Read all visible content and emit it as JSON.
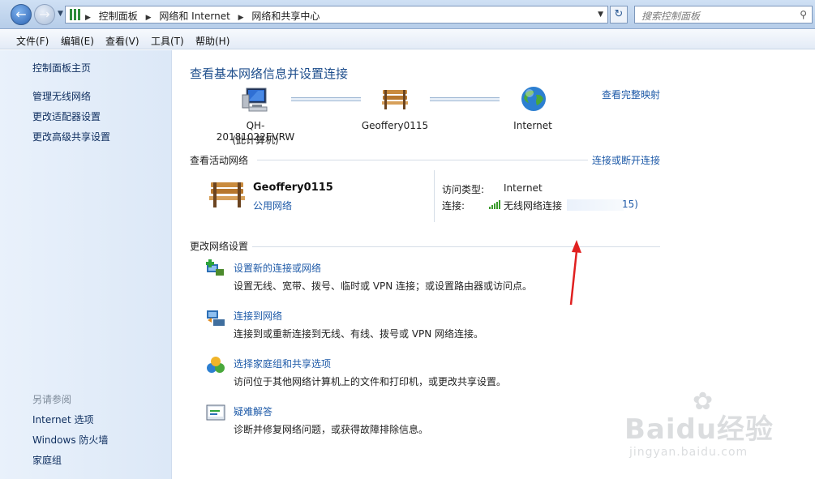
{
  "addressbar": {
    "crumbs": [
      "控制面板",
      "网络和 Internet",
      "网络和共享中心"
    ],
    "search_placeholder": "搜索控制面板"
  },
  "menubar": [
    "文件(F)",
    "编辑(E)",
    "查看(V)",
    "工具(T)",
    "帮助(H)"
  ],
  "sidebar": {
    "items": [
      "控制面板主页",
      "管理无线网络",
      "更改适配器设置",
      "更改高级共享设置"
    ],
    "see_also_header": "另请参阅",
    "see_also": [
      "Internet 选项",
      "Windows 防火墙",
      "家庭组"
    ]
  },
  "main": {
    "title": "查看基本网络信息并设置连接",
    "full_map_link": "查看完整映射",
    "nodes": [
      {
        "label": "QH-20181022EVRW",
        "sublabel": "(此计算机)",
        "icon": "computer-icon"
      },
      {
        "label": "Geoffery0115",
        "icon": "bench-icon"
      },
      {
        "label": "Internet",
        "icon": "globe-icon"
      }
    ],
    "active_networks": {
      "header": "查看活动网络",
      "connect_link": "连接或断开连接",
      "network_name": "Geoffery0115",
      "network_type": "公用网络",
      "access_type_label": "访问类型:",
      "access_type_value": "Internet",
      "connection_label": "连接:",
      "connection_value": "无线网络连接",
      "connection_suffix": "15)"
    },
    "change_settings": {
      "header": "更改网络设置",
      "tasks": [
        {
          "title": "设置新的连接或网络",
          "desc": "设置无线、宽带、拨号、临时或 VPN 连接；或设置路由器或访问点。",
          "icon": "new-connection-icon"
        },
        {
          "title": "连接到网络",
          "desc": "连接到或重新连接到无线、有线、拨号或 VPN 网络连接。",
          "icon": "connect-network-icon"
        },
        {
          "title": "选择家庭组和共享选项",
          "desc": "访问位于其他网络计算机上的文件和打印机，或更改共享设置。",
          "icon": "homegroup-icon"
        },
        {
          "title": "疑难解答",
          "desc": "诊断并修复网络问题，或获得故障排除信息。",
          "icon": "troubleshoot-icon"
        }
      ]
    }
  },
  "watermark": {
    "brand": "Baidu经验",
    "url": "jingyan.baidu.com"
  },
  "colors": {
    "link": "#1e5aa8",
    "title": "#1e4e8c",
    "annotation_arrow": "#e02020"
  }
}
